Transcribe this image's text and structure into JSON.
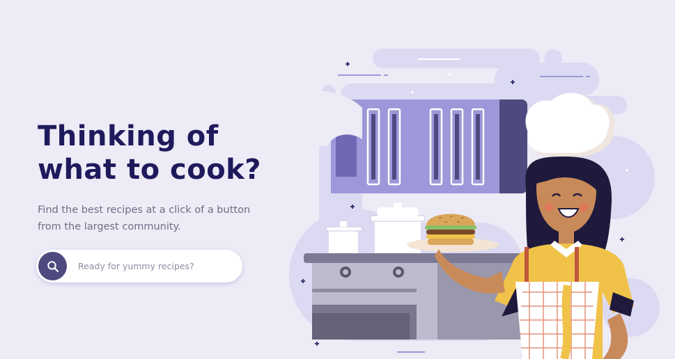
{
  "hero": {
    "title_line1": "Thinking of",
    "title_line2": "what to cook?",
    "subtitle": "Find the best recipes at a click of a button from the largest community."
  },
  "search": {
    "placeholder": "Ready for yummy recipes?",
    "icon": "search-icon"
  },
  "illustration": {
    "description_icon": "chef-with-burger-illustration"
  },
  "colors": {
    "background": "#ecebf6",
    "heading": "#1f1a5c",
    "body_text": "#6f6d86",
    "search_button": "#4e4a7f",
    "accent_lavender": "#9d98d9"
  }
}
